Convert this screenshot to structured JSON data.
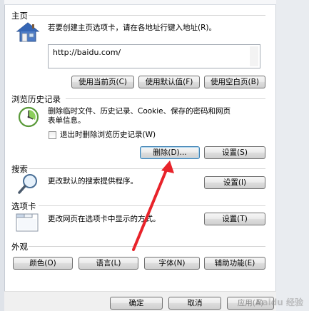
{
  "home": {
    "title": "主页",
    "description": "若要创建主页选项卡，请在各地址行键入地址(R)。",
    "url_value": "http://baidu.com/",
    "buttons": [
      "使用当前页(C)",
      "使用默认值(F)",
      "使用空白页(B)"
    ]
  },
  "history": {
    "title": "浏览历史记录",
    "description_line1": "删除临时文件、历史记录、Cookie、保存的密码和网页",
    "description_line2": "表单信息。",
    "checkbox_label": "退出时删除浏览历史记录(W)",
    "delete_button": "删除(D)...",
    "settings_button": "设置(S)"
  },
  "search": {
    "title": "搜索",
    "description": "更改默认的搜索提供程序。",
    "settings_button": "设置(I)"
  },
  "tabs": {
    "title": "选项卡",
    "description": "更改网页在选项卡中显示的方式。",
    "settings_button": "设置(T)"
  },
  "appearance": {
    "title": "外观",
    "buttons": [
      "颜色(O)",
      "语言(L)",
      "字体(N)",
      "辅助功能(E)"
    ]
  },
  "footer": {
    "ok": "确定",
    "cancel": "取消",
    "apply": "应用(A)"
  },
  "annotation": {
    "color": "#e8232a"
  },
  "icons": {
    "home": "house-icon",
    "history": "clock-history-icon",
    "search": "magnifier-icon",
    "tabs": "tab-window-icon"
  },
  "watermark": "Baidu 经验"
}
